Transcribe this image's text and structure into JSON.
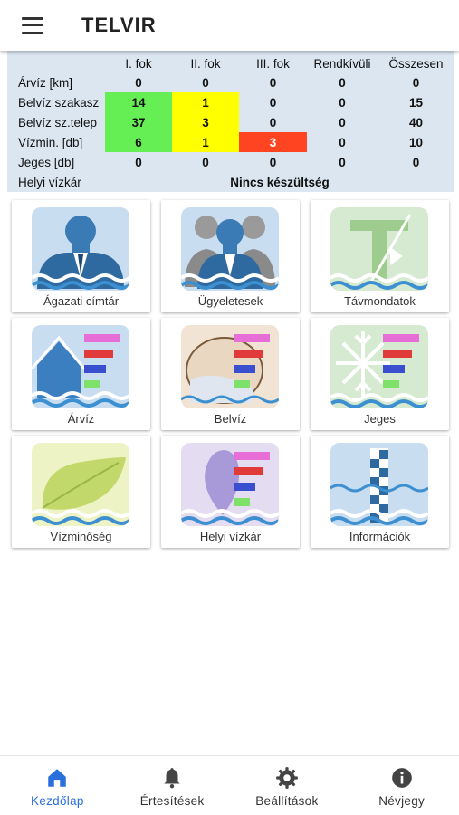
{
  "app": {
    "title": "TELVIR"
  },
  "status_table": {
    "headers": [
      "",
      "I. fok",
      "II. fok",
      "III. fok",
      "Rendkívüli",
      "Összesen"
    ],
    "rows": [
      {
        "label": "Árvíz [km]",
        "values": [
          "0",
          "0",
          "0",
          "0",
          "0"
        ]
      },
      {
        "label": "Belvíz szakasz",
        "values": [
          "14",
          "1",
          "0",
          "0",
          "15"
        ]
      },
      {
        "label": "Belvíz sz.telep",
        "values": [
          "37",
          "3",
          "0",
          "0",
          "40"
        ]
      },
      {
        "label": "Vízmin. [db]",
        "values": [
          "6",
          "1",
          "3",
          "0",
          "10"
        ]
      },
      {
        "label": "Jeges [db]",
        "values": [
          "0",
          "0",
          "0",
          "0",
          "0"
        ]
      }
    ],
    "local_row": {
      "label": "Helyi vízkár",
      "status": "Nincs készültség"
    },
    "colors": {
      "level1": "#66ee55",
      "level2": "#ffff00",
      "level3": "#ff4422",
      "panel": "#dbe6f1"
    }
  },
  "tiles": [
    {
      "label": "Ágazati címtár",
      "icon": "people-directory-icon"
    },
    {
      "label": "Ügyeletesek",
      "icon": "on-duty-people-icon"
    },
    {
      "label": "Távmondatok",
      "icon": "telegram-t-icon"
    },
    {
      "label": "Árvíz",
      "icon": "flood-house-icon"
    },
    {
      "label": "Belvíz",
      "icon": "inland-water-icon"
    },
    {
      "label": "Jeges",
      "icon": "ice-snowflake-icon"
    },
    {
      "label": "Vízminőség",
      "icon": "water-quality-leaf-icon"
    },
    {
      "label": "Helyi vízkár",
      "icon": "local-damage-drop-icon"
    },
    {
      "label": "Információk",
      "icon": "information-gauge-icon"
    }
  ],
  "bottom_nav": [
    {
      "label": "Kezdőlap",
      "icon": "home-icon",
      "active": true
    },
    {
      "label": "Értesítések",
      "icon": "bell-icon",
      "active": false
    },
    {
      "label": "Beállítások",
      "icon": "gear-icon",
      "active": false
    },
    {
      "label": "Névjegy",
      "icon": "info-icon",
      "active": false
    }
  ],
  "accent_color": "#2a6fdb"
}
